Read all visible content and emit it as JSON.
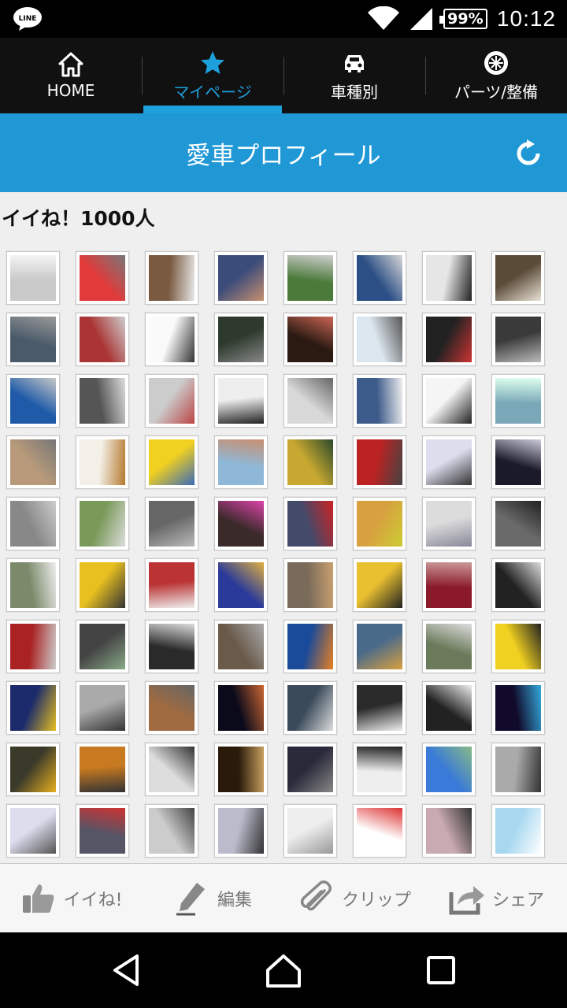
{
  "status": {
    "battery": "99%",
    "time": "10:12"
  },
  "nav": [
    {
      "label": "HOME",
      "icon": "home-icon"
    },
    {
      "label": "マイページ",
      "icon": "star-icon",
      "active": true
    },
    {
      "label": "車種別",
      "icon": "car-icon"
    },
    {
      "label": "パーツ/整備",
      "icon": "wheel-icon"
    }
  ],
  "page": {
    "title": "愛車プロフィール",
    "likes": "イイね！1000人"
  },
  "toolbar": {
    "like": "イイね!",
    "edit": "編集",
    "clip": "クリップ",
    "share": "シェア"
  },
  "colors": {
    "accent": "#1ea0dd",
    "titlebar": "#2198d6"
  }
}
